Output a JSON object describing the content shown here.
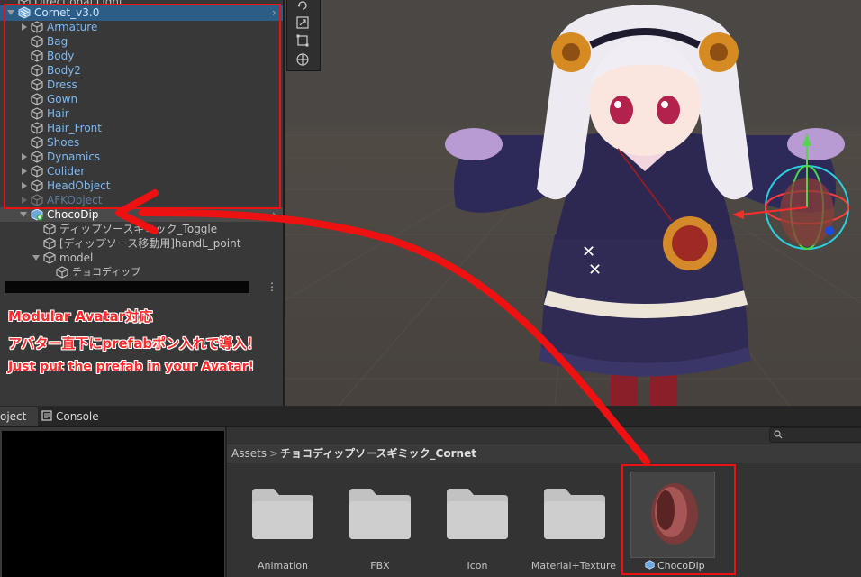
{
  "hierarchy": {
    "rows": [
      {
        "label": "Directional Light",
        "indent": 0,
        "arrow": "",
        "style": "normal"
      },
      {
        "label": "Cornet_v3.0",
        "indent": 0,
        "arrow": "down",
        "style": "blue-sel"
      },
      {
        "label": "Armature",
        "indent": 1,
        "arrow": "right",
        "style": "blue"
      },
      {
        "label": "Bag",
        "indent": 1,
        "arrow": "",
        "style": "blue"
      },
      {
        "label": "Body",
        "indent": 1,
        "arrow": "",
        "style": "blue"
      },
      {
        "label": "Body2",
        "indent": 1,
        "arrow": "",
        "style": "blue"
      },
      {
        "label": "Dress",
        "indent": 1,
        "arrow": "",
        "style": "blue"
      },
      {
        "label": "Gown",
        "indent": 1,
        "arrow": "",
        "style": "blue"
      },
      {
        "label": "Hair",
        "indent": 1,
        "arrow": "",
        "style": "blue"
      },
      {
        "label": "Hair_Front",
        "indent": 1,
        "arrow": "",
        "style": "blue"
      },
      {
        "label": "Shoes",
        "indent": 1,
        "arrow": "",
        "style": "blue"
      },
      {
        "label": "Dynamics",
        "indent": 1,
        "arrow": "right",
        "style": "blue"
      },
      {
        "label": "Colider",
        "indent": 1,
        "arrow": "right",
        "style": "blue"
      },
      {
        "label": "HeadObject",
        "indent": 1,
        "arrow": "right",
        "style": "blue"
      },
      {
        "label": "AFKObject",
        "indent": 1,
        "arrow": "right",
        "style": "dim"
      },
      {
        "label": "ChocoDip",
        "indent": 1,
        "arrow": "down",
        "style": "white"
      },
      {
        "label": "ディップソースギミック_Toggle",
        "indent": 2,
        "arrow": "",
        "style": "normal"
      },
      {
        "label": "[ディップソース移動用]handL_point",
        "indent": 2,
        "arrow": "",
        "style": "normal"
      },
      {
        "label": "model",
        "indent": 2,
        "arrow": "down",
        "style": "normal"
      },
      {
        "label": "チョコディップ",
        "indent": 3,
        "arrow": "",
        "style": "normal"
      }
    ],
    "more_icon": "⋮"
  },
  "annotations": {
    "line1": "Modular Avatar対応",
    "line2": "アバター直下にprefabポン入れで導入！",
    "line3": "Just put the prefab in your Avatar!"
  },
  "tabs": {
    "project": "oject",
    "console": "Console"
  },
  "breadcrumb": {
    "root": "Assets",
    "sep": ">",
    "folder": "チョコディップソースギミック_Cornet"
  },
  "assets": [
    {
      "label": "Animation",
      "kind": "folder"
    },
    {
      "label": "FBX",
      "kind": "folder"
    },
    {
      "label": "Icon",
      "kind": "folder"
    },
    {
      "label": "Material+Texture",
      "kind": "folder"
    },
    {
      "label": "ChocoDip",
      "kind": "prefab"
    }
  ],
  "icons": {
    "tools": [
      "rotate-icon",
      "scale-icon",
      "rect-icon",
      "transform-icon"
    ],
    "search": "search-icon",
    "console": "console-icon"
  },
  "colors": {
    "highlight_red": "#ee1111",
    "prefab_blue": "#7db9f2",
    "selection": "#2c5d87"
  }
}
